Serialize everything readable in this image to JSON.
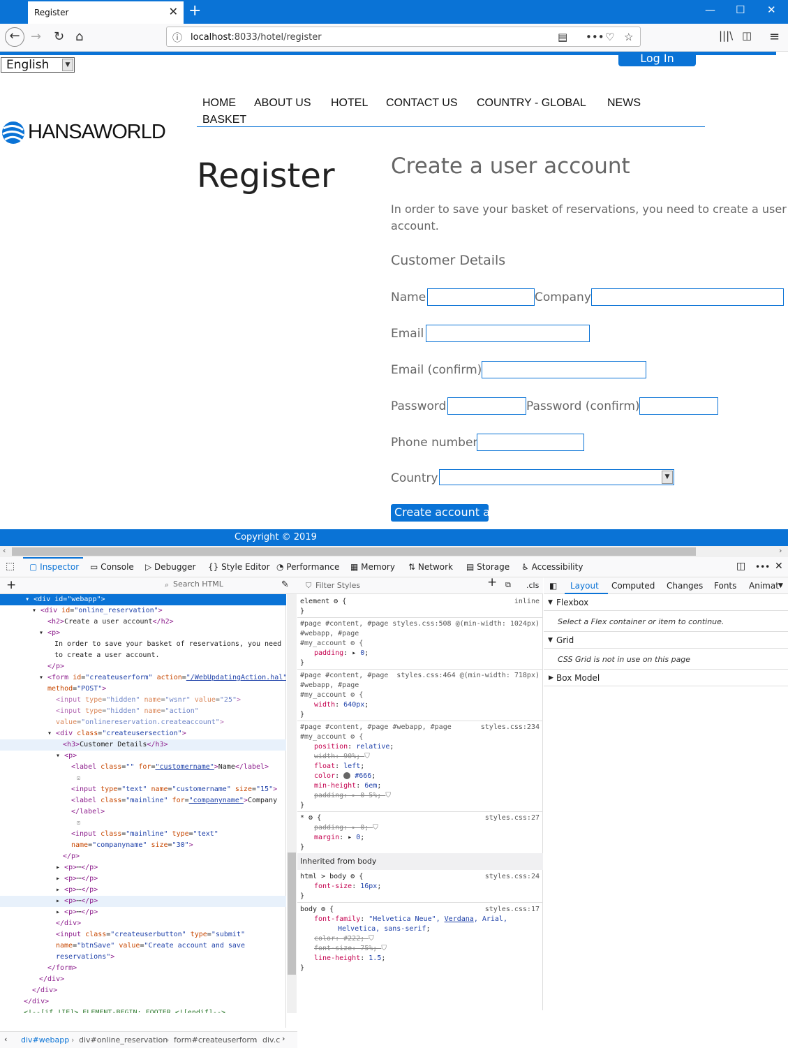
{
  "browser": {
    "tab_title": "Register",
    "url_host": "localhost",
    "url_rest": ":8033/hotel/register"
  },
  "site": {
    "language": "English",
    "login": "Log In",
    "logo": "HANSAWORLD",
    "menu": [
      "HOME",
      "ABOUT US",
      "HOTEL",
      "CONTACT US",
      "COUNTRY - GLOBAL",
      "NEWS",
      "BASKET"
    ],
    "page_heading": "Register",
    "form_heading": "Create a user account",
    "intro": "In order to save your basket of reservations, you need to create a user account.",
    "details_heading": "Customer Details",
    "labels": {
      "name": "Name",
      "company": "Company",
      "email": "Email",
      "email_confirm": "Email (confirm)",
      "password": "Password",
      "password_confirm": "Password (confirm)",
      "phone": "Phone number",
      "country": "Country"
    },
    "submit": "Create account and save reservations",
    "copyright": "Copyright © 2019"
  },
  "devtools": {
    "tabs": [
      "Inspector",
      "Console",
      "Debugger",
      "Style Editor",
      "Performance",
      "Memory",
      "Network",
      "Storage",
      "Accessibility"
    ],
    "search_placeholder": "Search HTML",
    "filter_placeholder": "Filter Styles",
    "cls": ".cls",
    "layout_tabs": [
      "Layout",
      "Computed",
      "Changes",
      "Fonts",
      "Animat"
    ],
    "flexbox": "Flexbox",
    "flexbox_note": "Select a Flex container or item to continue.",
    "grid": "Grid",
    "grid_note": "CSS Grid is not in use on this page",
    "box_model": "Box Model",
    "inherited": "Inherited from body",
    "breadcrumbs": [
      "div#webapp",
      "div#online_reservation",
      "form#createuserform",
      "div.c"
    ]
  }
}
